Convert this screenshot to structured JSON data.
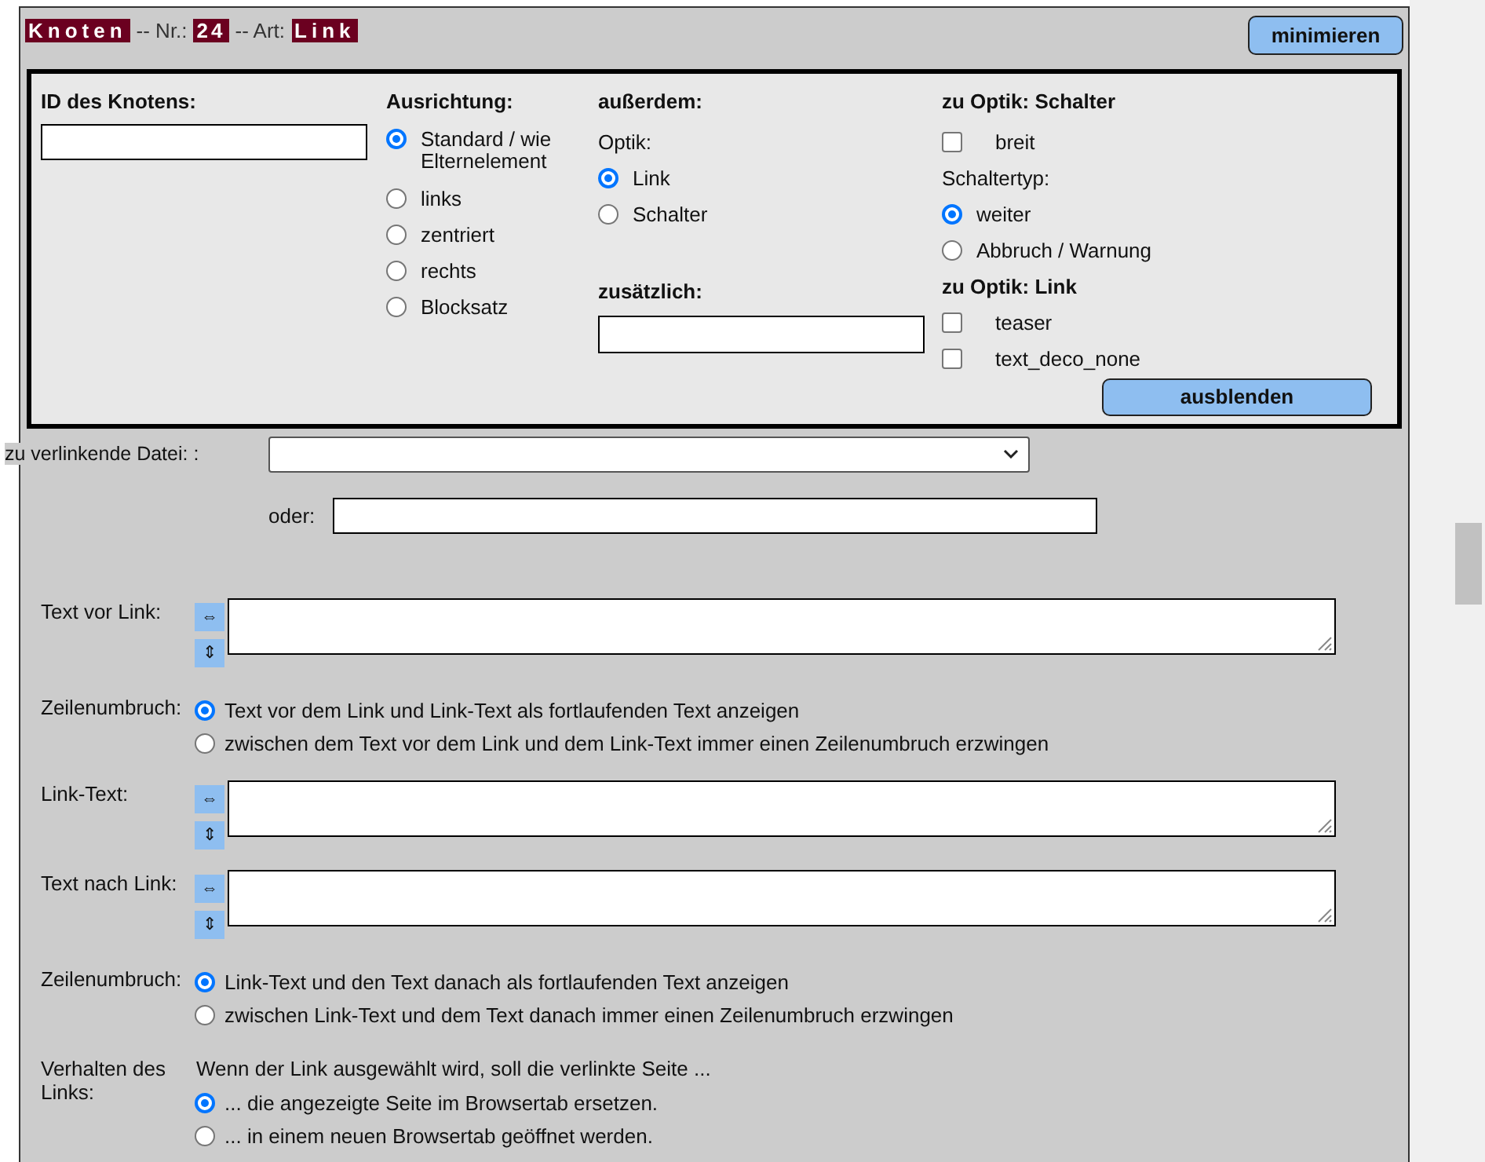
{
  "header": {
    "node_label": "Knoten",
    "nr_label": "-- Nr.:",
    "nr": "24",
    "type_label": "-- Art:",
    "type": "Link"
  },
  "minimize_button": "minimieren",
  "settings": {
    "id_field": {
      "label": "ID des Knotens:"
    },
    "alignment": {
      "label": "Ausrichtung:",
      "options": [
        {
          "label": "Standard / wie Elternelement",
          "selected": true
        },
        {
          "label": "links",
          "selected": false
        },
        {
          "label": "zentriert",
          "selected": false
        },
        {
          "label": "rechts",
          "selected": false
        },
        {
          "label": "Blocksatz",
          "selected": false
        }
      ]
    },
    "extra": {
      "heading": "außerdem:",
      "optik_label": "Optik:",
      "optik_options": [
        {
          "label": "Link",
          "selected": true
        },
        {
          "label": "Schalter",
          "selected": false
        }
      ],
      "additional_label": "zusätzlich:"
    },
    "button_options": {
      "heading": "zu Optik: Schalter",
      "checkboxes": [
        {
          "label": "breit",
          "checked": false
        }
      ],
      "type_label": "Schaltertyp:",
      "type_options": [
        {
          "label": "weiter",
          "selected": true
        },
        {
          "label": "Abbruch / Warnung",
          "selected": false
        }
      ]
    },
    "link_options": {
      "heading": "zu Optik: Link",
      "checkboxes": [
        {
          "label": "teaser",
          "checked": false
        },
        {
          "label": "text_deco_none",
          "checked": false
        }
      ]
    },
    "hide_button": "ausblenden"
  },
  "file": {
    "label": "zu verlinkende Datei: :",
    "or_label": "oder:"
  },
  "rows": [
    {
      "kind": "text",
      "label": "Text vor Link:",
      "widen": "⇔",
      "heighten": "⇕"
    },
    {
      "kind": "choice",
      "label": "Zeilenumbruch:",
      "options": [
        {
          "label": "Text vor dem Link und Link-Text als fortlaufenden Text anzeigen",
          "selected": true
        },
        {
          "label": "zwischen dem Text vor dem Link und dem Link-Text immer einen Zeilenumbruch erzwingen",
          "selected": false
        }
      ]
    },
    {
      "kind": "text",
      "label": "Link-Text:",
      "widen": "⇔",
      "heighten": "⇕"
    },
    {
      "kind": "text",
      "label": "Text nach Link:",
      "widen": "⇔",
      "heighten": "⇕"
    },
    {
      "kind": "choice",
      "label": "Zeilenumbruch:",
      "options": [
        {
          "label": "Link-Text und den Text danach als fortlaufenden Text anzeigen",
          "selected": true
        },
        {
          "label": "zwischen Link-Text und dem Text danach immer einen Zeilenumbruch erzwingen",
          "selected": false
        }
      ]
    },
    {
      "kind": "behavior",
      "label": "Verhalten des Links:",
      "intro": "Wenn der Link ausgewählt wird, soll die verlinkte Seite ...",
      "options": [
        {
          "label": "... die angezeigte Seite im Browsertab ersetzen.",
          "selected": true
        },
        {
          "label": "... in einem neuen Browsertab geöffnet werden.",
          "selected": false
        }
      ]
    }
  ]
}
